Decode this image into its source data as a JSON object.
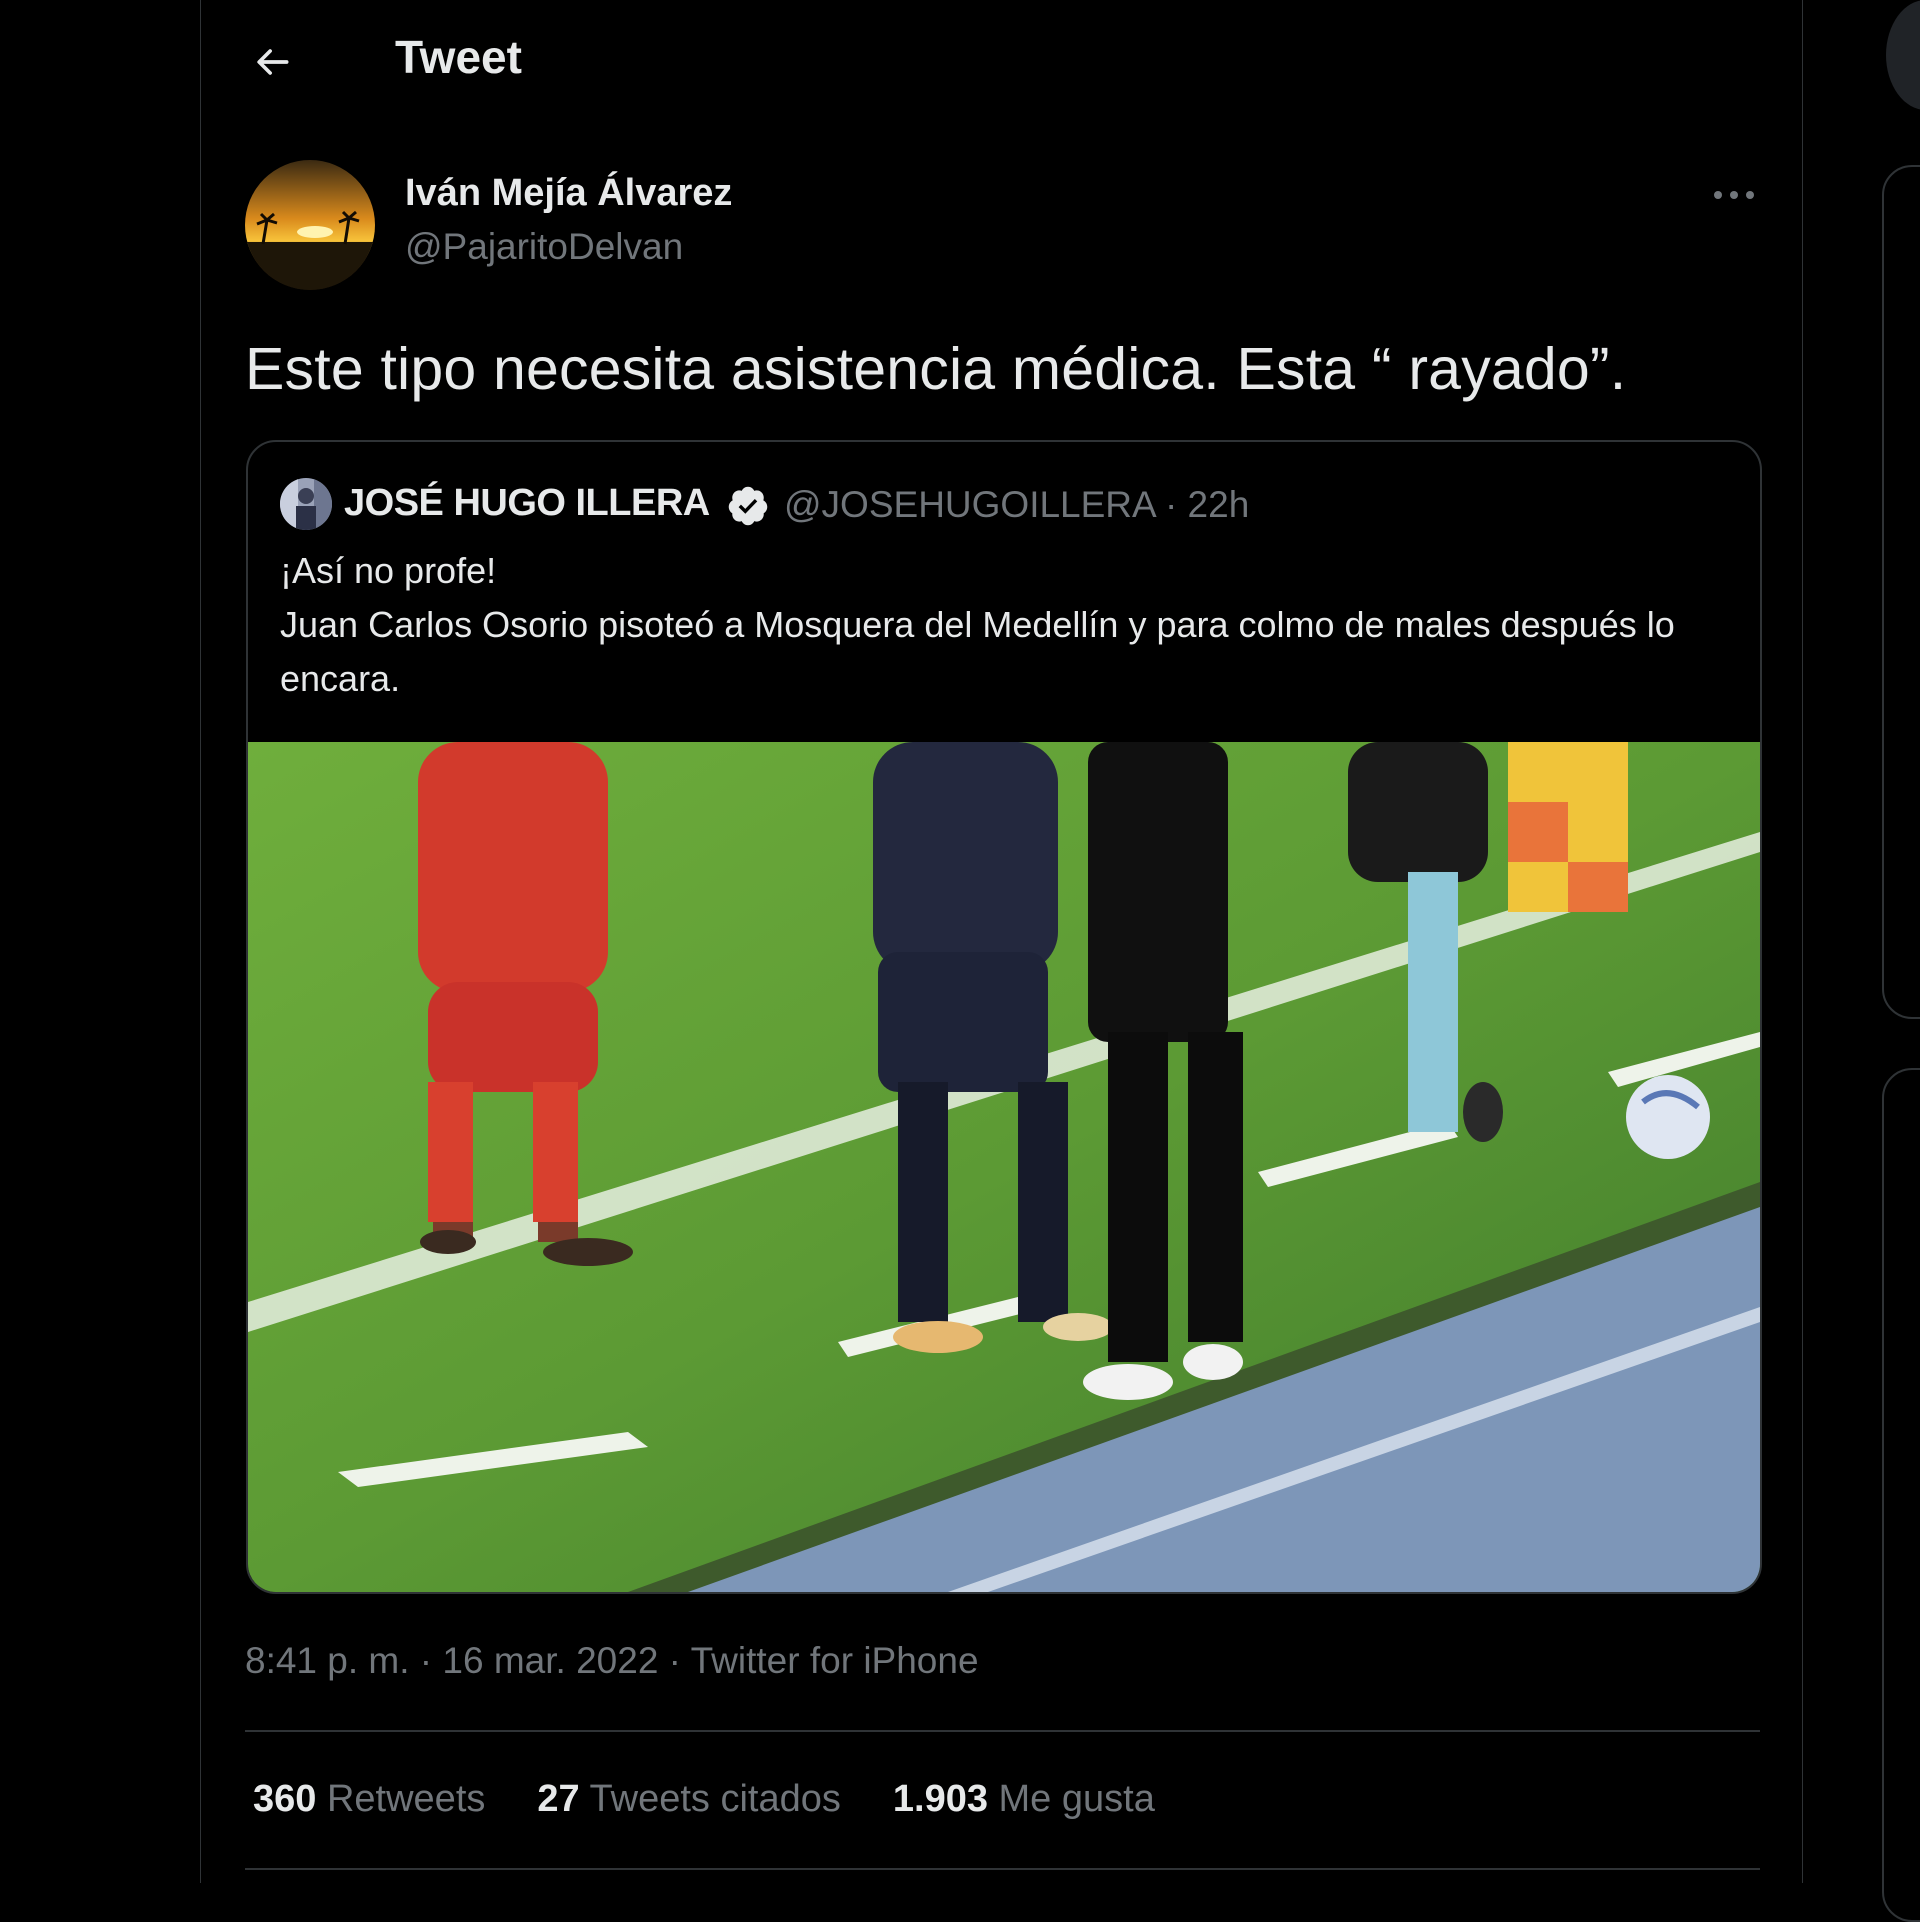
{
  "header": {
    "title": "Tweet"
  },
  "tweet": {
    "author_name": "Iván Mejía Álvarez",
    "author_handle": "@PajaritoDelvan",
    "text": "Este tipo necesita asistencia médica. Esta “ rayado”.",
    "timestamp": "8:41 p. m. · 16 mar. 2022",
    "separator": " · ",
    "source": "Twitter for iPhone"
  },
  "quoted": {
    "author_name": "JOSÉ HUGO ILLERA",
    "handle_time": "@JOSEHUGOILLERA · 22h",
    "text": "¡Así no profe!\nJuan Carlos Osorio pisoteó a Mosquera del Medellín y para colmo de males después lo encara."
  },
  "stats": [
    {
      "count": "360",
      "label": "Retweets"
    },
    {
      "count": "27",
      "label": "Tweets citados"
    },
    {
      "count": "1.903",
      "label": "Me gusta"
    }
  ],
  "icons": {
    "back": "arrow-left-icon",
    "more": "more-horizontal-icon",
    "verified": "verified-badge-icon"
  },
  "colors": {
    "background": "#000000",
    "text_primary": "#e7e9ea",
    "text_secondary": "#71767b",
    "border": "#2f3336"
  }
}
